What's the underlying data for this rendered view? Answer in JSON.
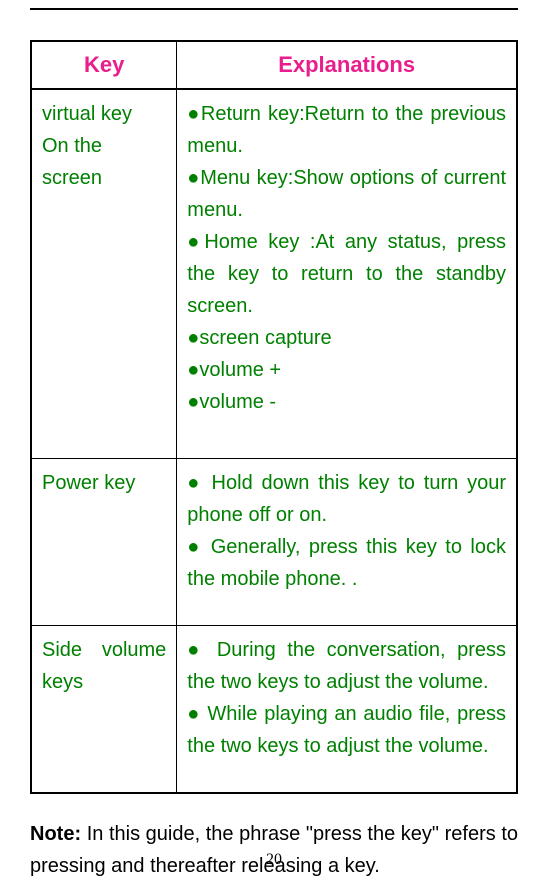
{
  "headers": {
    "key": "Key",
    "explanations": "Explanations"
  },
  "rows": [
    {
      "key_line1": "virtual key",
      "key_line2": "On the screen",
      "bullets": [
        "●Return key:Return to the previous menu.",
        "●Menu key:Show options of current menu.",
        "●Home key :At any status, press the key to return to the standby screen.",
        "●screen capture",
        "●volume +",
        "●volume -"
      ]
    },
    {
      "key_line1": "Power key",
      "key_line2": "",
      "bullets": [
        "● Hold down this key to turn your phone off or on.",
        "● Generally, press this key to lock the mobile phone. ."
      ]
    },
    {
      "key_line1": "Side volume keys",
      "key_line2": "",
      "bullets": [
        "● During the conversation, press the two keys to adjust the volume.",
        "● While playing an audio file, press the two keys to adjust the volume."
      ]
    }
  ],
  "note": {
    "label": "Note:",
    "text": " In this guide, the phrase \"press the key\" refers to pressing and thereafter releasing a key."
  },
  "page_number": "20"
}
